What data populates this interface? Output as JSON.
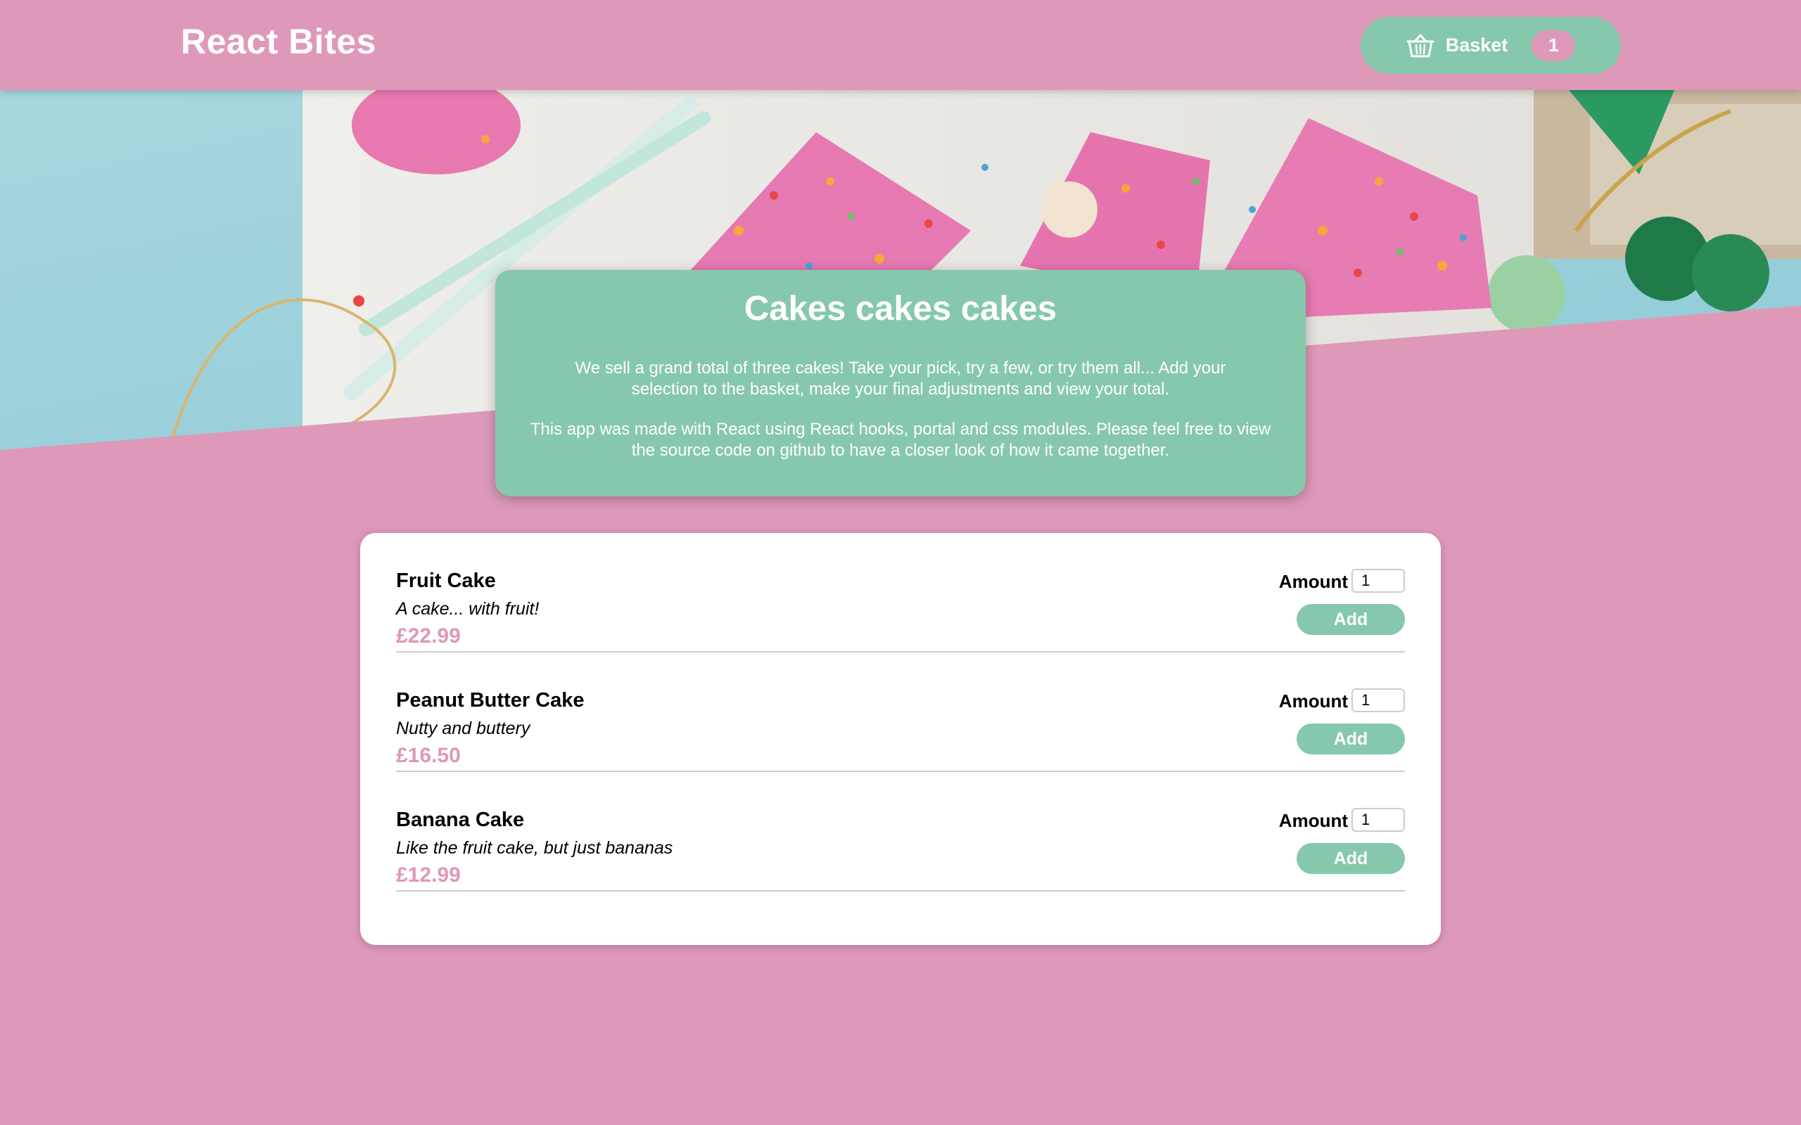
{
  "header": {
    "title": "React Bites",
    "basket_label": "Basket",
    "basket_count": "1",
    "basket_icon": "basket-icon"
  },
  "summary": {
    "title": "Cakes cakes cakes",
    "paragraph1": "We sell a grand total of three cakes! Take your pick, try a few, or try them all... Add your selection to the basket, make your final adjustments and view your total.",
    "paragraph2": "This app was made with React using React hooks, portal and css modules. Please feel free to view the source code on github to have a closer look of how it came together."
  },
  "meals": [
    {
      "name": "Fruit Cake",
      "description": "A cake... with fruit!",
      "price": "£22.99",
      "amount_label": "Amount",
      "amount": "1",
      "add_label": "Add"
    },
    {
      "name": "Peanut Butter Cake",
      "description": "Nutty and buttery",
      "price": "£16.50",
      "amount_label": "Amount",
      "amount": "1",
      "add_label": "Add"
    },
    {
      "name": "Banana Cake",
      "description": "Like the fruit cake, but just bananas",
      "price": "£12.99",
      "amount_label": "Amount",
      "amount": "1",
      "add_label": "Add"
    }
  ],
  "colors": {
    "background": "#de99b9",
    "accent": "#86c8ab",
    "price": "#de99b9",
    "card": "#ffffff"
  }
}
